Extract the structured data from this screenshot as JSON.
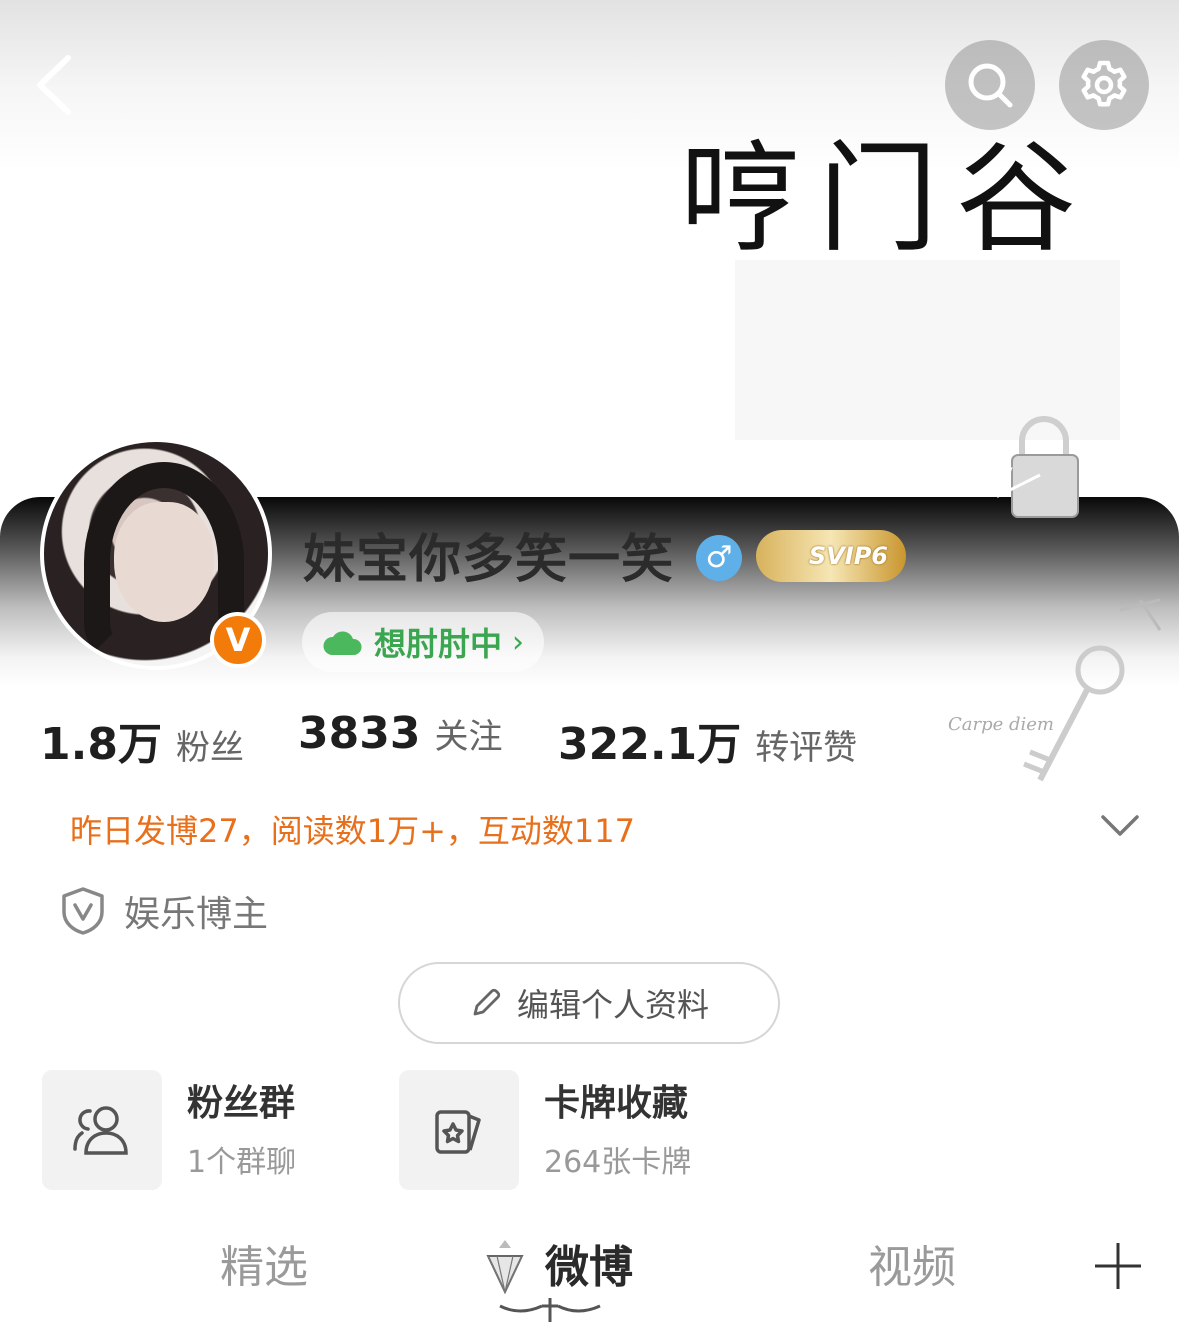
{
  "header": {
    "cover_text": "哼门谷"
  },
  "profile": {
    "username": "妹宝你多笑一笑",
    "gender_symbol": "♂",
    "svip_label": "SVIP6",
    "verified_badge": "V",
    "mood": "想肘肘中",
    "mood_arrow": "›"
  },
  "stats": [
    {
      "value": "1.8万",
      "label": "粉丝"
    },
    {
      "value": "3833",
      "label": "关注"
    },
    {
      "value": "322.1万",
      "label": "转评赞"
    }
  ],
  "summary": "昨日发博27，阅读数1万+，互动数117",
  "category": "娱乐博主",
  "edit_profile_label": "编辑个人资料",
  "cards": [
    {
      "title": "粉丝群",
      "subtitle": "1个群聊",
      "icon": "users-icon"
    },
    {
      "title": "卡牌收藏",
      "subtitle": "264张卡牌",
      "icon": "card-star-icon"
    }
  ],
  "tabs": [
    {
      "label": "精选",
      "active": false
    },
    {
      "label": "微博",
      "active": true
    },
    {
      "label": "视频",
      "active": false
    }
  ],
  "decor_text": "Carpe diem",
  "colors": {
    "accent_orange": "#e8701c",
    "mood_green": "#3aa650",
    "verified_orange": "#f27b0a",
    "gender_blue": "#5fb0e8"
  }
}
